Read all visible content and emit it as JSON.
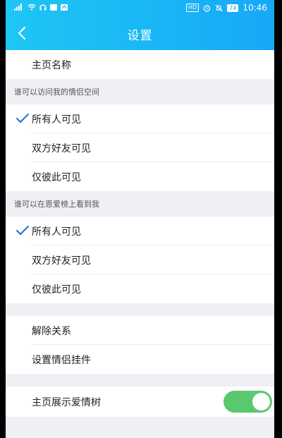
{
  "status_bar": {
    "hd": "HD",
    "battery": "74",
    "time": "10:46"
  },
  "header": {
    "title": "设置"
  },
  "homepage_name": {
    "label": "主页名称"
  },
  "section_space": {
    "title": "谁可以访问我的情侣空间",
    "options": [
      "所有人可见",
      "双方好友可见",
      "仅彼此可见"
    ],
    "selected_index": 0
  },
  "section_ranking": {
    "title": "谁可以在恩爱榜上看到我",
    "options": [
      "所有人可见",
      "双方好友可见",
      "仅彼此可见"
    ],
    "selected_index": 0
  },
  "actions": {
    "unbind": "解除关系",
    "widget": "设置情侣挂件"
  },
  "love_tree": {
    "label": "主页展示爱情树",
    "enabled": true
  },
  "colors": {
    "header_start": "#1ec6f5",
    "header_end": "#17a8f6",
    "check": "#1a73c8",
    "toggle_on": "#5bc870"
  },
  "icons": {
    "back": "chevron-left-icon",
    "check": "checkmark-icon"
  }
}
